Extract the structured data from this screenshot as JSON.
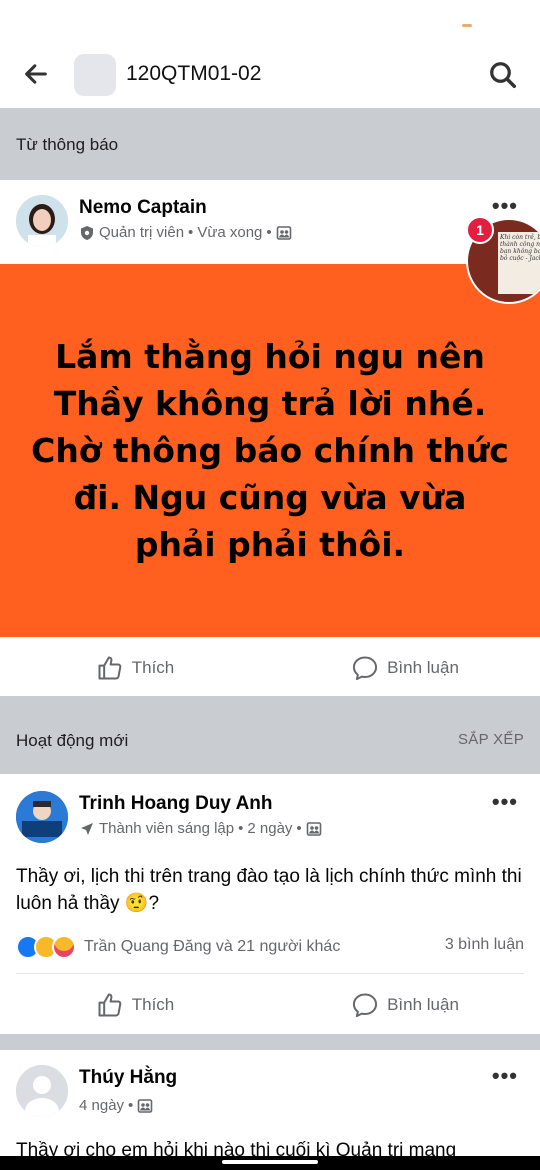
{
  "header": {
    "title": "120QTM01-02"
  },
  "sections": {
    "announcements_label": "Từ thông báo",
    "activity_label": "Hoạt động mới",
    "sort_label": "SẮP XẾP"
  },
  "pinned_post": {
    "author": "Nemo Captain",
    "role": "Quản trị viên",
    "time": "Vừa xong",
    "separator": "•",
    "text": "Lắm thằng hỏi ngu nên Thầy không trả lời nhé. Chờ thông báo chính thức đi. Ngu cũng vừa vừa phải phải thôi.",
    "banner_color": "#ff5f1f",
    "like_label": "Thích",
    "comment_label": "Bình luận"
  },
  "floating_chat": {
    "badge": "1",
    "preview_text": "Khi còn trẻ, bạn sẽ thành công nếu bạn không bao giờ bỏ cuộc - Jack Ma -"
  },
  "posts": [
    {
      "author": "Trinh Hoang Duy Anh",
      "role": "Thành viên sáng lập",
      "time": "2 ngày",
      "text": "Thầy ơi,  lịch thi trên trang đào tạo là lịch chính thức mình thi luôn hả thầy 🤨?",
      "reactions_text": "Trần Quang Đăng và 21 người khác",
      "comments": "3 bình luận",
      "like_label": "Thích",
      "comment_label": "Bình luận"
    },
    {
      "author": "Thúy Hằng",
      "time": "4 ngày",
      "text": "Thầy ơi cho em hỏi khi nào thi cuối kì Quản trị mạng"
    }
  ],
  "colors": {
    "accent": "#1877f2",
    "muted": "#65676b",
    "section_bg": "#c9ccd1"
  }
}
